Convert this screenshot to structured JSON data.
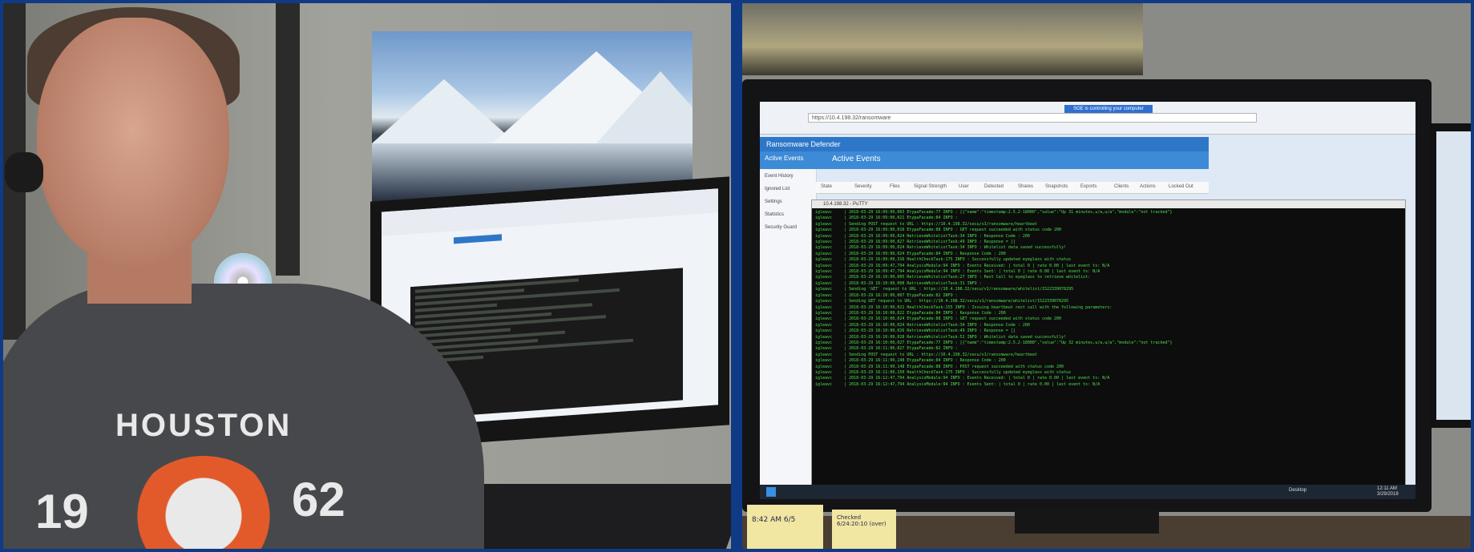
{
  "right_screen": {
    "banner": "SGE is controlling your computer",
    "browser_url": "https://10.4.198.32/ransomware",
    "app_title": "Ransomware Defender",
    "tabs": [
      "Active Events",
      "Active Events"
    ],
    "sidebar_items": [
      "Event History",
      "Ignored List",
      "Settings",
      "Statistics",
      "Security Guard"
    ],
    "columns": [
      "State",
      "Severity",
      "Files",
      "Signal Strength",
      "User",
      "Detected",
      "Shares",
      "Snapshots",
      "Exports",
      "Clients",
      "Actions",
      "Locked Out"
    ],
    "ssh_title": "10.4.198.32 - PuTTY",
    "log_lines": [
      "igleavc     | 2018-03-29 16:09:00,003 EtypaFacade:77 INFO : [{\"name\":\"timestamp:2.5.2-18080\",\"value\":\"Up 31 minutes,u/a,u/a\",\"module\":\"not tracked\"}",
      "igleavc     | 2018-03-29 16:09:00,021 EtypaFacade:84 INFO :",
      "igleavc     | Sending POST request to URL : https://10.4.198.32/secu/v1/ransomware/heartbeat",
      "igleavc     | 2018-03-29 16:09:00,010 EtypaFacade:88 INFO : GET request succeeded with status code 200",
      "igleavc     | 2018-03-29 16:09:00,024 RetrieveWhitelistTask:34 INFO : Response Code : 200",
      "igleavc     | 2018-03-29 16:09:00,027 RetrieveWhitelistTask:49 INFO : Response = []",
      "igleavc     | 2018-03-29 16:09:00,024 RetrieveWhitelistTask:34 INFO : Whitelist data saved successfully!",
      "igleavc     | 2018-03-29 16:09:00,024 EtypaFacade:84 INFO : Response Code : 200",
      "igleavc     | 2018-03-29 16:09:00,316 HealthCheckTask:175 INFO : Successfully updated eyeglass with status",
      "igleavc     | 2018-03-29 16:09:47,794 AnalysisModule:94 INFO : Events Received: | total 0 | rate 0.00 | last event ts: N/A",
      "igleavc     | 2018-03-29 16:09:47,794 AnalysisModule:94 INFO : Events Sent: | total 0 | rate 0.00 | last event ts: N/A",
      "igleavc     | 2018-03-29 16:10:00,005 RetrieveWhitelistTask:27 INFO : Rest Call to eyeglass to retrieve whitelist:",
      "igleavc     | 2018-03-29 16:10:00,008 RetrieveWhitelistTask:31 INFO :",
      "igleavc     | Sending 'GET' request to URL : https://10.4.198.32/secu/v1/ransomware/whitelist/1522339078295",
      "igleavc     | 2018-03-29 16:10:00,007 EtypaFacade:82 INFO :",
      "igleavc     | Sending GET request to URL : https://10.4.198.32/secu/v1/ransomware/whitelist/1522339078295",
      "igleavc     | 2018-03-29 16:10:00,021 HealthCheckTask:155 INFO : Issuing heartbeat rest call with the following parameters:",
      "igleavc     | 2018-03-29 16:10:00,022 EtypaFacade:84 INFO : Response Code : 200",
      "igleavc     | 2018-03-29 16:10:00,024 EtypaFacade:88 INFO : GET request succeeded with status code 200",
      "igleavc     | 2018-03-29 16:10:00,024 RetrieveWhitelistTask:34 INFO : Response Code : 200",
      "igleavc     | 2018-03-29 16:10:00,026 RetrieveWhitelistTask:49 INFO : Response = []",
      "igleavc     | 2018-03-29 16:10:00,028 RetrieveWhitelistTask:51 INFO : Whitelist data saved successfully!",
      "igleavc     | 2018-03-29 16:10:00,027 EtypaFacade:77 INFO : [{\"name\":\"timestamp:2.5.2-18080\",\"value\":\"Up 32 minutes,u/a,u/a\",\"module\":\"not tracked\"}",
      "igleavc     | 2018-03-29 16:11:00,027 EtypaFacade:82 INFO :",
      "igleavc     | Sending POST request to URL : https://10.4.198.32/secu/v1/ransomware/heartbeat",
      "igleavc     | 2018-03-29 16:11:00,148 EtypaFacade:84 INFO : Response Code : 200",
      "igleavc     | 2018-03-29 16:11:00,148 EtypaFacade:88 INFO : POST request succeeded with status code 200",
      "igleavc     | 2018-03-29 16:11:00,150 HealthCheckTask:175 INFO : Successfully updated eyeglass with status",
      "igleavc     | 2018-03-29 16:12:47,794 AnalysisModule:94 INFO : Events Received: | total 0 | rate 0.00 | last event ts: N/A",
      "igleavc     | 2018-03-29 16:12:47,794 AnalysisModule:94 INFO : Events Sent: | total 0 | rate 0.00 | last event ts: N/A"
    ],
    "taskbar_desktop": "Desktop",
    "taskbar_time": "12:11 AM",
    "taskbar_date": "3/29/2018"
  },
  "shirt": {
    "city": "HOUSTON",
    "year_left": "19",
    "year_right": "62"
  },
  "sticky_notes": {
    "note_a": "8:42 AM 6/5",
    "note_b": "Checked 6/24:20:10 (over)"
  }
}
